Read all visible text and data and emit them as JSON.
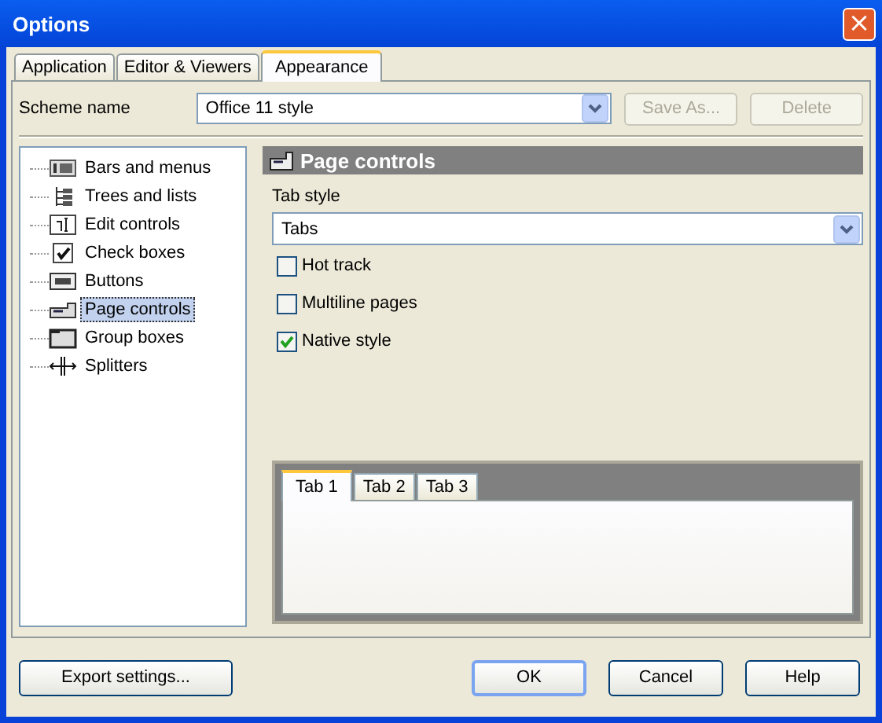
{
  "window": {
    "title": "Options",
    "close": "×"
  },
  "tabs": [
    {
      "label": "Application",
      "selected": false
    },
    {
      "label": "Editor & Viewers",
      "selected": false
    },
    {
      "label": "Appearance",
      "selected": true
    }
  ],
  "scheme": {
    "label": "Scheme name",
    "value": "Office 11 style",
    "buttons": [
      {
        "label": "Save As...",
        "disabled": true
      },
      {
        "label": "Delete",
        "disabled": true
      }
    ]
  },
  "tree": [
    {
      "label": "Bars and menus",
      "kind": "bars",
      "selected": false
    },
    {
      "label": "Trees and lists",
      "kind": "tree",
      "selected": false
    },
    {
      "label": "Edit controls",
      "kind": "edit",
      "selected": false
    },
    {
      "label": "Check boxes",
      "kind": "check",
      "selected": false
    },
    {
      "label": "Buttons",
      "kind": "button",
      "selected": false
    },
    {
      "label": "Page controls",
      "kind": "page",
      "selected": true
    },
    {
      "label": "Group boxes",
      "kind": "group",
      "selected": false
    },
    {
      "label": "Splitters",
      "kind": "splitter",
      "selected": false
    }
  ],
  "section": {
    "title": "Page controls",
    "tab_style_label": "Tab style",
    "tab_style": "Tabs",
    "options": [
      {
        "label": "Hot track",
        "checked": false
      },
      {
        "label": "Multiline pages",
        "checked": false
      },
      {
        "label": "Native style",
        "checked": true
      }
    ],
    "preview_tabs": [
      {
        "label": "Tab 1",
        "selected": true
      },
      {
        "label": "Tab 2",
        "selected": false
      },
      {
        "label": "Tab 3",
        "selected": false
      }
    ]
  },
  "footer": {
    "export": "Export settings...",
    "buttons": [
      "OK",
      "Cancel",
      "Help"
    ]
  }
}
